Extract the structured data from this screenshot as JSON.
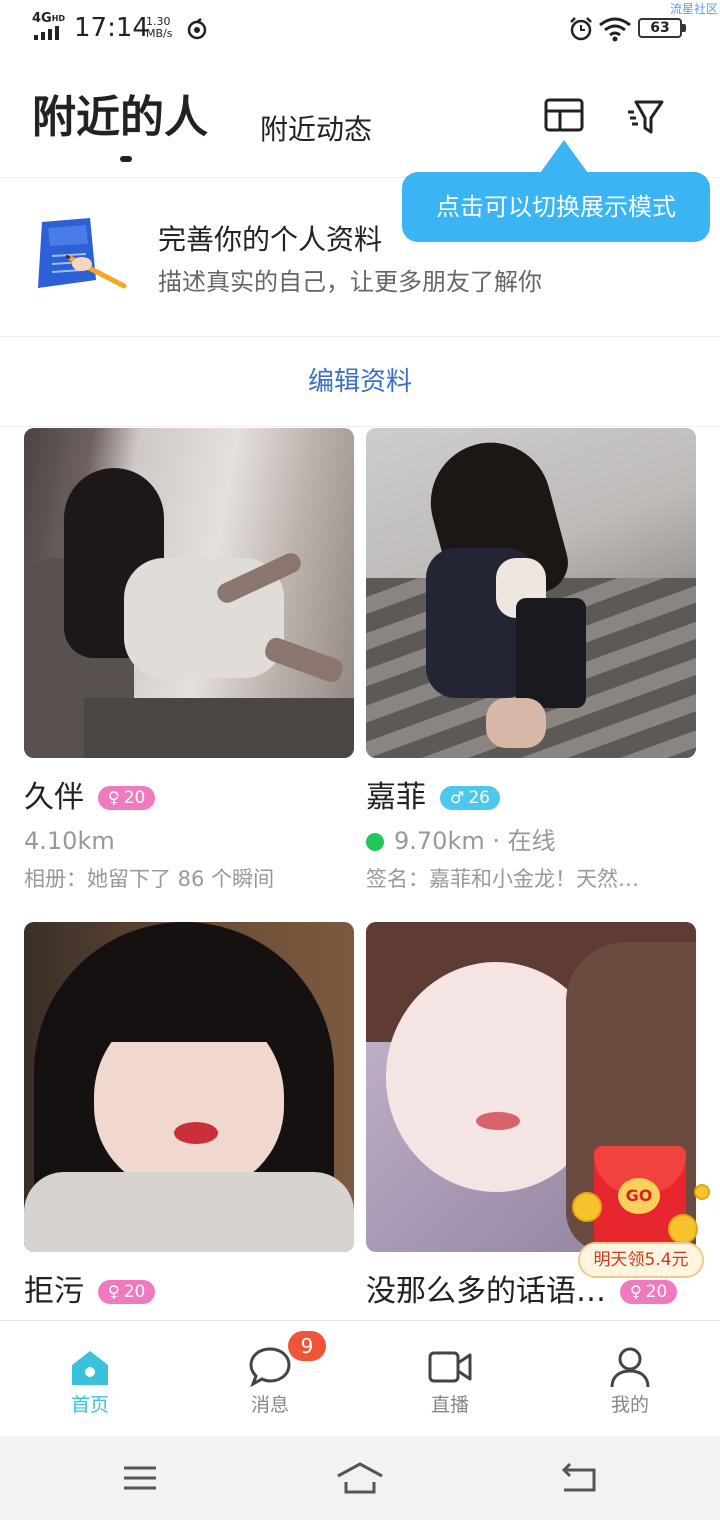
{
  "status_bar": {
    "network": "4G",
    "network_hd": "HD",
    "time": "17:14",
    "speed_value": "1.30",
    "speed_unit": "MB/s",
    "battery": "63",
    "watermark": "流星社区"
  },
  "header": {
    "tab_active": "附近的人",
    "tab_other": "附近动态"
  },
  "tooltip": {
    "text": "点击可以切换展示模式"
  },
  "profile_prompt": {
    "title": "完善你的个人资料",
    "subtitle": "描述真实的自己，让更多朋友了解你",
    "edit_link": "编辑资料"
  },
  "users": [
    {
      "name": "久伴",
      "gender_symbol": "♀",
      "age": "20",
      "distance": "4.10km",
      "status": "",
      "desc": "相册：她留下了 86 个瞬间"
    },
    {
      "name": "嘉菲",
      "gender_symbol": "♂",
      "age": "26",
      "distance": "9.70km",
      "status": " · 在线",
      "desc": "签名：嘉菲和小金龙！天然…"
    },
    {
      "name": "拒污",
      "gender_symbol": "♀",
      "age": "20"
    },
    {
      "name": "没那么多的话语…",
      "gender_symbol": "♀",
      "age": "20"
    }
  ],
  "promo": {
    "go_label": "GO",
    "label": "明天领5.4元"
  },
  "bottom_nav": {
    "items": [
      {
        "label": "首页",
        "icon": "home-icon",
        "active": true
      },
      {
        "label": "消息",
        "icon": "message-icon",
        "badge": "9"
      },
      {
        "label": "直播",
        "icon": "video-icon"
      },
      {
        "label": "我的",
        "icon": "profile-icon"
      }
    ]
  },
  "colors": {
    "accent": "#3ab4f2",
    "active_nav": "#3ac2dc",
    "link": "#3a6fc9",
    "female_badge": "#f07ac0",
    "male_badge": "#4fc7ec",
    "online": "#22c65a",
    "message_badge": "#f05538"
  }
}
